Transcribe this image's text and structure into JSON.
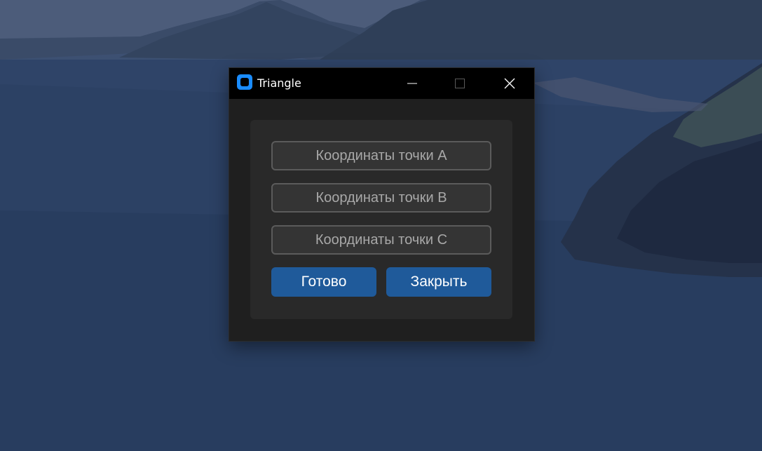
{
  "window": {
    "title": "Triangle",
    "icon": "app-logo-icon",
    "controls": {
      "minimize_icon": "minimize-icon",
      "maximize_icon": "maximize-icon",
      "close_icon": "close-icon"
    }
  },
  "form": {
    "point_a_placeholder": "Координаты точки A",
    "point_b_placeholder": "Координаты точки B",
    "point_c_placeholder": "Координаты точки C",
    "done_label": "Готово",
    "close_label": "Закрыть"
  },
  "colors": {
    "accent": "#1f5a9a",
    "window_bg": "#1f1f1f",
    "panel_bg": "#292929",
    "titlebar_bg": "#000000",
    "icon_blue": "#1a8cff"
  }
}
